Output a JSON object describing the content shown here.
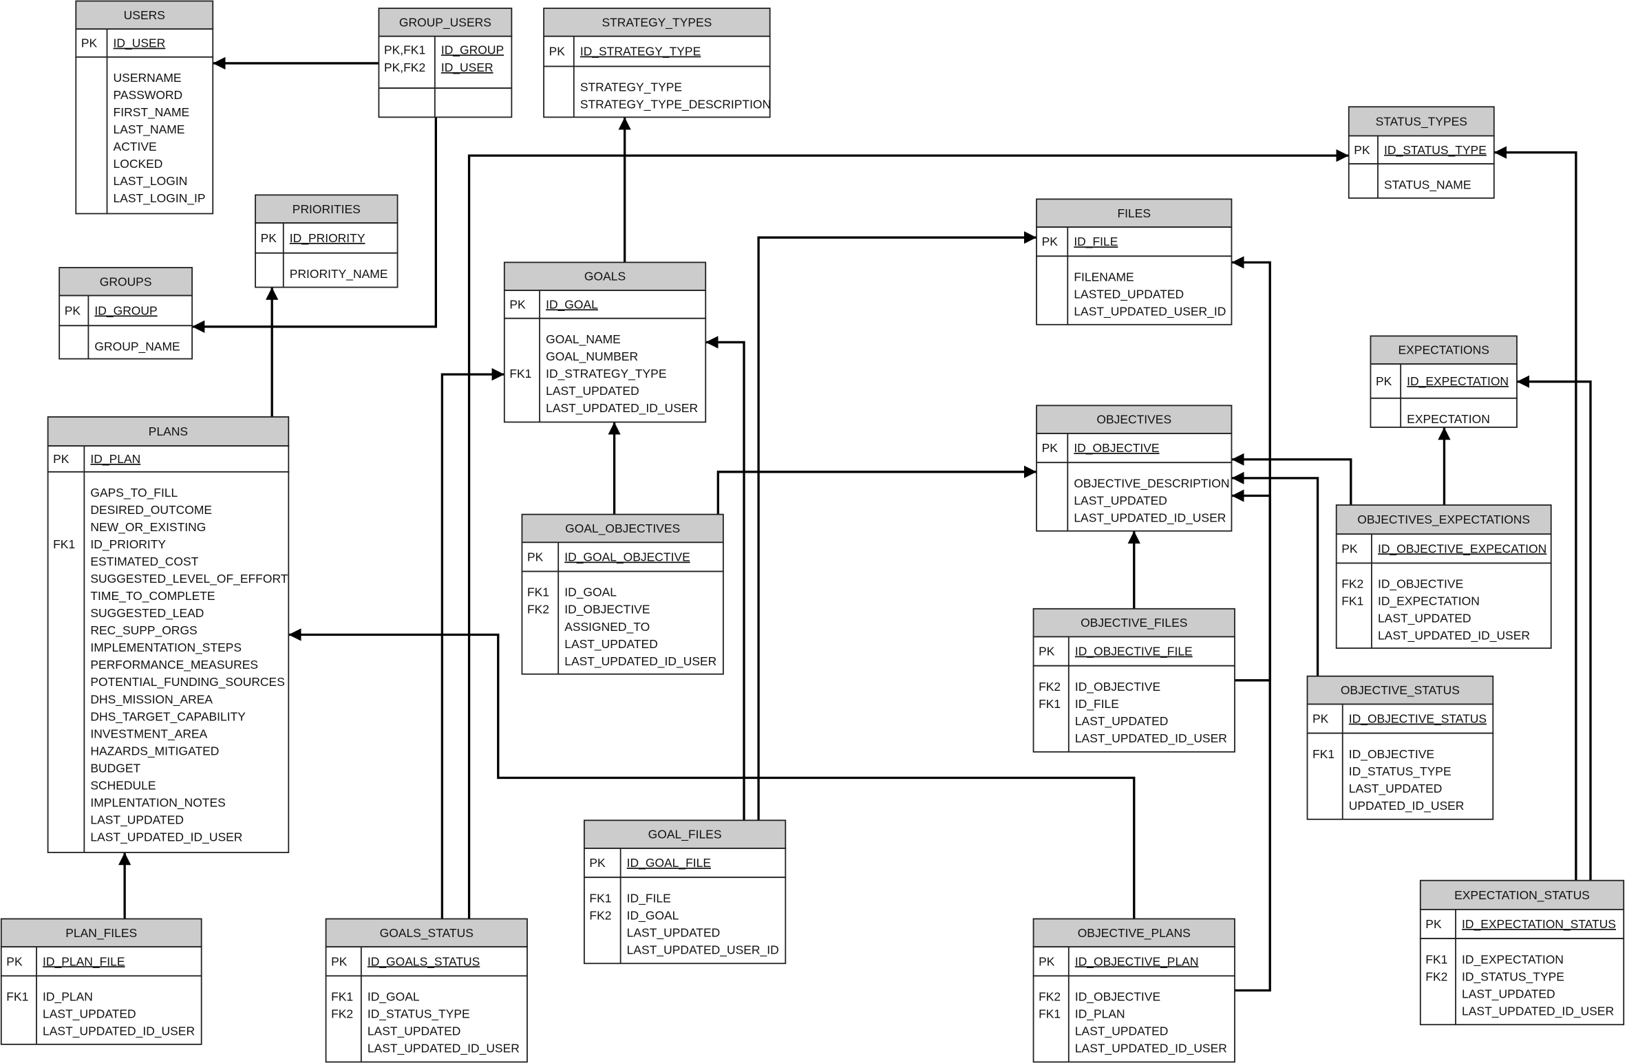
{
  "diagram": {
    "tables": [
      {
        "id": "users",
        "name": "USERS",
        "pk": [
          {
            "key": "PK",
            "name": "ID_USER"
          }
        ],
        "fields": [
          {
            "key": "",
            "name": "USERNAME"
          },
          {
            "key": "",
            "name": "PASSWORD"
          },
          {
            "key": "",
            "name": "FIRST_NAME"
          },
          {
            "key": "",
            "name": "LAST_NAME"
          },
          {
            "key": "",
            "name": "ACTIVE"
          },
          {
            "key": "",
            "name": "LOCKED"
          },
          {
            "key": "",
            "name": "LAST_LOGIN"
          },
          {
            "key": "",
            "name": "LAST_LOGIN_IP"
          }
        ]
      },
      {
        "id": "group_users",
        "name": "GROUP_USERS",
        "pk": [
          {
            "key": "PK,FK1",
            "name": "ID_GROUP"
          },
          {
            "key": "PK,FK2",
            "name": "ID_USER"
          }
        ],
        "fields": []
      },
      {
        "id": "strategy_types",
        "name": "STRATEGY_TYPES",
        "pk": [
          {
            "key": "PK",
            "name": "ID_STRATEGY_TYPE"
          }
        ],
        "fields": [
          {
            "key": "",
            "name": "STRATEGY_TYPE"
          },
          {
            "key": "",
            "name": "STRATEGY_TYPE_DESCRIPTION"
          }
        ]
      },
      {
        "id": "status_types",
        "name": "STATUS_TYPES",
        "pk": [
          {
            "key": "PK",
            "name": "ID_STATUS_TYPE"
          }
        ],
        "fields": [
          {
            "key": "",
            "name": "STATUS_NAME"
          }
        ]
      },
      {
        "id": "priorities",
        "name": "PRIORITIES",
        "pk": [
          {
            "key": "PK",
            "name": "ID_PRIORITY"
          }
        ],
        "fields": [
          {
            "key": "",
            "name": "PRIORITY_NAME"
          }
        ]
      },
      {
        "id": "groups",
        "name": "GROUPS",
        "pk": [
          {
            "key": "PK",
            "name": "ID_GROUP"
          }
        ],
        "fields": [
          {
            "key": "",
            "name": "GROUP_NAME"
          }
        ]
      },
      {
        "id": "files",
        "name": "FILES",
        "pk": [
          {
            "key": "PK",
            "name": "ID_FILE"
          }
        ],
        "fields": [
          {
            "key": "",
            "name": "FILENAME"
          },
          {
            "key": "",
            "name": "LASTED_UPDATED"
          },
          {
            "key": "",
            "name": "LAST_UPDATED_USER_ID"
          }
        ]
      },
      {
        "id": "goals",
        "name": "GOALS",
        "pk": [
          {
            "key": "PK",
            "name": "ID_GOAL"
          }
        ],
        "fields": [
          {
            "key": "",
            "name": "GOAL_NAME"
          },
          {
            "key": "",
            "name": "GOAL_NUMBER"
          },
          {
            "key": "FK1",
            "name": "ID_STRATEGY_TYPE"
          },
          {
            "key": "",
            "name": "LAST_UPDATED"
          },
          {
            "key": "",
            "name": "LAST_UPDATED_ID_USER"
          }
        ]
      },
      {
        "id": "expectations",
        "name": "EXPECTATIONS",
        "pk": [
          {
            "key": "PK",
            "name": "ID_EXPECTATION"
          }
        ],
        "fields": [
          {
            "key": "",
            "name": "EXPECTATION"
          }
        ]
      },
      {
        "id": "objectives",
        "name": "OBJECTIVES",
        "pk": [
          {
            "key": "PK",
            "name": "ID_OBJECTIVE"
          }
        ],
        "fields": [
          {
            "key": "",
            "name": "OBJECTIVE_DESCRIPTION"
          },
          {
            "key": "",
            "name": "LAST_UPDATED"
          },
          {
            "key": "",
            "name": "LAST_UPDATED_ID_USER"
          }
        ]
      },
      {
        "id": "plans",
        "name": "PLANS",
        "pk": [
          {
            "key": "PK",
            "name": "ID_PLAN"
          }
        ],
        "fields": [
          {
            "key": "",
            "name": "GAPS_TO_FILL"
          },
          {
            "key": "",
            "name": "DESIRED_OUTCOME"
          },
          {
            "key": "",
            "name": "NEW_OR_EXISTING"
          },
          {
            "key": "FK1",
            "name": "ID_PRIORITY"
          },
          {
            "key": "",
            "name": "ESTIMATED_COST"
          },
          {
            "key": "",
            "name": "SUGGESTED_LEVEL_OF_EFFORT"
          },
          {
            "key": "",
            "name": "TIME_TO_COMPLETE"
          },
          {
            "key": "",
            "name": "SUGGESTED_LEAD"
          },
          {
            "key": "",
            "name": "REC_SUPP_ORGS"
          },
          {
            "key": "",
            "name": "IMPLEMENTATION_STEPS"
          },
          {
            "key": "",
            "name": "PERFORMANCE_MEASURES"
          },
          {
            "key": "",
            "name": "POTENTIAL_FUNDING_SOURCES"
          },
          {
            "key": "",
            "name": "DHS_MISSION_AREA"
          },
          {
            "key": "",
            "name": "DHS_TARGET_CAPABILITY"
          },
          {
            "key": "",
            "name": "INVESTMENT_AREA"
          },
          {
            "key": "",
            "name": "HAZARDS_MITIGATED"
          },
          {
            "key": "",
            "name": "BUDGET"
          },
          {
            "key": "",
            "name": "SCHEDULE"
          },
          {
            "key": "",
            "name": "IMPLENTATION_NOTES"
          },
          {
            "key": "",
            "name": "LAST_UPDATED"
          },
          {
            "key": "",
            "name": "LAST_UPDATED_ID_USER"
          }
        ]
      },
      {
        "id": "goal_objectives",
        "name": "GOAL_OBJECTIVES",
        "pk": [
          {
            "key": "PK",
            "name": "ID_GOAL_OBJECTIVE"
          }
        ],
        "fields": [
          {
            "key": "FK1",
            "name": "ID_GOAL"
          },
          {
            "key": "FK2",
            "name": "ID_OBJECTIVE"
          },
          {
            "key": "",
            "name": "ASSIGNED_TO"
          },
          {
            "key": "",
            "name": "LAST_UPDATED"
          },
          {
            "key": "",
            "name": "LAST_UPDATED_ID_USER"
          }
        ]
      },
      {
        "id": "objectives_expectations",
        "name": "OBJECTIVES_EXPECTATIONS",
        "pk": [
          {
            "key": "PK",
            "name": "ID_OBJECTIVE_EXPECATION"
          }
        ],
        "fields": [
          {
            "key": "FK2",
            "name": "ID_OBJECTIVE"
          },
          {
            "key": "FK1",
            "name": "ID_EXPECTATION"
          },
          {
            "key": "",
            "name": "LAST_UPDATED"
          },
          {
            "key": "",
            "name": "LAST_UPDATED_ID_USER"
          }
        ]
      },
      {
        "id": "objective_files",
        "name": "OBJECTIVE_FILES",
        "pk": [
          {
            "key": "PK",
            "name": "ID_OBJECTIVE_FILE"
          }
        ],
        "fields": [
          {
            "key": "FK2",
            "name": "ID_OBJECTIVE"
          },
          {
            "key": "FK1",
            "name": "ID_FILE"
          },
          {
            "key": "",
            "name": "LAST_UPDATED"
          },
          {
            "key": "",
            "name": "LAST_UPDATED_ID_USER"
          }
        ]
      },
      {
        "id": "objective_status",
        "name": "OBJECTIVE_STATUS",
        "pk": [
          {
            "key": "PK",
            "name": "ID_OBJECTIVE_STATUS"
          }
        ],
        "fields": [
          {
            "key": "FK1",
            "name": "ID_OBJECTIVE"
          },
          {
            "key": "",
            "name": "ID_STATUS_TYPE"
          },
          {
            "key": "",
            "name": "LAST_UPDATED"
          },
          {
            "key": "",
            "name": "UPDATED_ID_USER"
          }
        ]
      },
      {
        "id": "goal_files",
        "name": "GOAL_FILES",
        "pk": [
          {
            "key": "PK",
            "name": "ID_GOAL_FILE"
          }
        ],
        "fields": [
          {
            "key": "FK1",
            "name": "ID_FILE"
          },
          {
            "key": "FK2",
            "name": "ID_GOAL"
          },
          {
            "key": "",
            "name": "LAST_UPDATED"
          },
          {
            "key": "",
            "name": "LAST_UPDATED_USER_ID"
          }
        ]
      },
      {
        "id": "expectation_status",
        "name": "EXPECTATION_STATUS",
        "pk": [
          {
            "key": "PK",
            "name": "ID_EXPECTATION_STATUS"
          }
        ],
        "fields": [
          {
            "key": "FK1",
            "name": "ID_EXPECTATION"
          },
          {
            "key": "FK2",
            "name": "ID_STATUS_TYPE"
          },
          {
            "key": "",
            "name": "LAST_UPDATED"
          },
          {
            "key": "",
            "name": "LAST_UPDATED_ID_USER"
          }
        ]
      },
      {
        "id": "plan_files",
        "name": "PLAN_FILES",
        "pk": [
          {
            "key": "PK",
            "name": "ID_PLAN_FILE"
          }
        ],
        "fields": [
          {
            "key": "FK1",
            "name": "ID_PLAN"
          },
          {
            "key": "",
            "name": "LAST_UPDATED"
          },
          {
            "key": "",
            "name": "LAST_UPDATED_ID_USER"
          }
        ]
      },
      {
        "id": "goals_status",
        "name": "GOALS_STATUS",
        "pk": [
          {
            "key": "PK",
            "name": "ID_GOALS_STATUS"
          }
        ],
        "fields": [
          {
            "key": "FK1",
            "name": "ID_GOAL"
          },
          {
            "key": "FK2",
            "name": "ID_STATUS_TYPE"
          },
          {
            "key": "",
            "name": "LAST_UPDATED"
          },
          {
            "key": "",
            "name": "LAST_UPDATED_ID_USER"
          }
        ]
      },
      {
        "id": "objective_plans",
        "name": "OBJECTIVE_PLANS",
        "pk": [
          {
            "key": "PK",
            "name": "ID_OBJECTIVE_PLAN"
          }
        ],
        "fields": [
          {
            "key": "FK2",
            "name": "ID_OBJECTIVE"
          },
          {
            "key": "FK1",
            "name": "ID_PLAN"
          },
          {
            "key": "",
            "name": "LAST_UPDATED"
          },
          {
            "key": "",
            "name": "LAST_UPDATED_ID_USER"
          }
        ]
      }
    ],
    "relationships": [
      {
        "from": "group_users",
        "to": "users"
      },
      {
        "from": "group_users",
        "to": "groups"
      },
      {
        "from": "plans",
        "to": "priorities"
      },
      {
        "from": "goals",
        "to": "strategy_types"
      },
      {
        "from": "goals_status",
        "to": "status_types"
      },
      {
        "from": "goals_status",
        "to": "goals"
      },
      {
        "from": "goal_objectives",
        "to": "goals"
      },
      {
        "from": "goal_objectives",
        "to": "objectives"
      },
      {
        "from": "goal_files",
        "to": "goals"
      },
      {
        "from": "goal_files",
        "to": "files"
      },
      {
        "from": "objective_plans",
        "to": "plans"
      },
      {
        "from": "plan_files",
        "to": "plans"
      },
      {
        "from": "objective_files",
        "to": "objectives"
      },
      {
        "from": "objective_files",
        "to": "files"
      },
      {
        "from": "objective_plans",
        "to": "objectives"
      },
      {
        "from": "objectives_expectations",
        "to": "objectives"
      },
      {
        "from": "objective_status",
        "to": "objectives"
      },
      {
        "from": "objectives_expectations",
        "to": "expectations"
      },
      {
        "from": "expectation_status",
        "to": "status_types"
      },
      {
        "from": "expectation_status",
        "to": "expectations"
      }
    ]
  }
}
